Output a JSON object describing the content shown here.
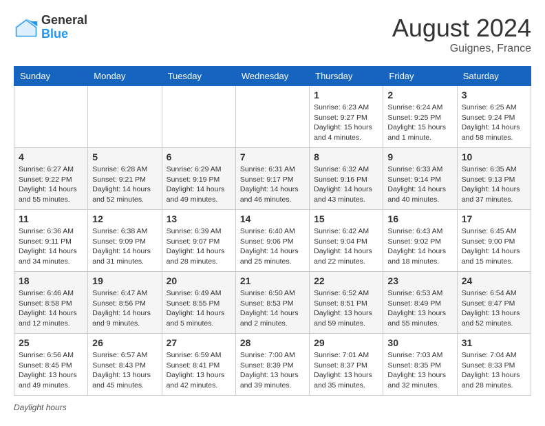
{
  "header": {
    "logo_general": "General",
    "logo_blue": "Blue",
    "month_year": "August 2024",
    "location": "Guignes, France"
  },
  "footer": {
    "daylight_label": "Daylight hours"
  },
  "days_of_week": [
    "Sunday",
    "Monday",
    "Tuesday",
    "Wednesday",
    "Thursday",
    "Friday",
    "Saturday"
  ],
  "weeks": [
    [
      {
        "day": "",
        "sunrise": "",
        "sunset": "",
        "daylight": ""
      },
      {
        "day": "",
        "sunrise": "",
        "sunset": "",
        "daylight": ""
      },
      {
        "day": "",
        "sunrise": "",
        "sunset": "",
        "daylight": ""
      },
      {
        "day": "",
        "sunrise": "",
        "sunset": "",
        "daylight": ""
      },
      {
        "day": "1",
        "sunrise": "Sunrise: 6:23 AM",
        "sunset": "Sunset: 9:27 PM",
        "daylight": "Daylight: 15 hours and 4 minutes."
      },
      {
        "day": "2",
        "sunrise": "Sunrise: 6:24 AM",
        "sunset": "Sunset: 9:25 PM",
        "daylight": "Daylight: 15 hours and 1 minute."
      },
      {
        "day": "3",
        "sunrise": "Sunrise: 6:25 AM",
        "sunset": "Sunset: 9:24 PM",
        "daylight": "Daylight: 14 hours and 58 minutes."
      }
    ],
    [
      {
        "day": "4",
        "sunrise": "Sunrise: 6:27 AM",
        "sunset": "Sunset: 9:22 PM",
        "daylight": "Daylight: 14 hours and 55 minutes."
      },
      {
        "day": "5",
        "sunrise": "Sunrise: 6:28 AM",
        "sunset": "Sunset: 9:21 PM",
        "daylight": "Daylight: 14 hours and 52 minutes."
      },
      {
        "day": "6",
        "sunrise": "Sunrise: 6:29 AM",
        "sunset": "Sunset: 9:19 PM",
        "daylight": "Daylight: 14 hours and 49 minutes."
      },
      {
        "day": "7",
        "sunrise": "Sunrise: 6:31 AM",
        "sunset": "Sunset: 9:17 PM",
        "daylight": "Daylight: 14 hours and 46 minutes."
      },
      {
        "day": "8",
        "sunrise": "Sunrise: 6:32 AM",
        "sunset": "Sunset: 9:16 PM",
        "daylight": "Daylight: 14 hours and 43 minutes."
      },
      {
        "day": "9",
        "sunrise": "Sunrise: 6:33 AM",
        "sunset": "Sunset: 9:14 PM",
        "daylight": "Daylight: 14 hours and 40 minutes."
      },
      {
        "day": "10",
        "sunrise": "Sunrise: 6:35 AM",
        "sunset": "Sunset: 9:13 PM",
        "daylight": "Daylight: 14 hours and 37 minutes."
      }
    ],
    [
      {
        "day": "11",
        "sunrise": "Sunrise: 6:36 AM",
        "sunset": "Sunset: 9:11 PM",
        "daylight": "Daylight: 14 hours and 34 minutes."
      },
      {
        "day": "12",
        "sunrise": "Sunrise: 6:38 AM",
        "sunset": "Sunset: 9:09 PM",
        "daylight": "Daylight: 14 hours and 31 minutes."
      },
      {
        "day": "13",
        "sunrise": "Sunrise: 6:39 AM",
        "sunset": "Sunset: 9:07 PM",
        "daylight": "Daylight: 14 hours and 28 minutes."
      },
      {
        "day": "14",
        "sunrise": "Sunrise: 6:40 AM",
        "sunset": "Sunset: 9:06 PM",
        "daylight": "Daylight: 14 hours and 25 minutes."
      },
      {
        "day": "15",
        "sunrise": "Sunrise: 6:42 AM",
        "sunset": "Sunset: 9:04 PM",
        "daylight": "Daylight: 14 hours and 22 minutes."
      },
      {
        "day": "16",
        "sunrise": "Sunrise: 6:43 AM",
        "sunset": "Sunset: 9:02 PM",
        "daylight": "Daylight: 14 hours and 18 minutes."
      },
      {
        "day": "17",
        "sunrise": "Sunrise: 6:45 AM",
        "sunset": "Sunset: 9:00 PM",
        "daylight": "Daylight: 14 hours and 15 minutes."
      }
    ],
    [
      {
        "day": "18",
        "sunrise": "Sunrise: 6:46 AM",
        "sunset": "Sunset: 8:58 PM",
        "daylight": "Daylight: 14 hours and 12 minutes."
      },
      {
        "day": "19",
        "sunrise": "Sunrise: 6:47 AM",
        "sunset": "Sunset: 8:56 PM",
        "daylight": "Daylight: 14 hours and 9 minutes."
      },
      {
        "day": "20",
        "sunrise": "Sunrise: 6:49 AM",
        "sunset": "Sunset: 8:55 PM",
        "daylight": "Daylight: 14 hours and 5 minutes."
      },
      {
        "day": "21",
        "sunrise": "Sunrise: 6:50 AM",
        "sunset": "Sunset: 8:53 PM",
        "daylight": "Daylight: 14 hours and 2 minutes."
      },
      {
        "day": "22",
        "sunrise": "Sunrise: 6:52 AM",
        "sunset": "Sunset: 8:51 PM",
        "daylight": "Daylight: 13 hours and 59 minutes."
      },
      {
        "day": "23",
        "sunrise": "Sunrise: 6:53 AM",
        "sunset": "Sunset: 8:49 PM",
        "daylight": "Daylight: 13 hours and 55 minutes."
      },
      {
        "day": "24",
        "sunrise": "Sunrise: 6:54 AM",
        "sunset": "Sunset: 8:47 PM",
        "daylight": "Daylight: 13 hours and 52 minutes."
      }
    ],
    [
      {
        "day": "25",
        "sunrise": "Sunrise: 6:56 AM",
        "sunset": "Sunset: 8:45 PM",
        "daylight": "Daylight: 13 hours and 49 minutes."
      },
      {
        "day": "26",
        "sunrise": "Sunrise: 6:57 AM",
        "sunset": "Sunset: 8:43 PM",
        "daylight": "Daylight: 13 hours and 45 minutes."
      },
      {
        "day": "27",
        "sunrise": "Sunrise: 6:59 AM",
        "sunset": "Sunset: 8:41 PM",
        "daylight": "Daylight: 13 hours and 42 minutes."
      },
      {
        "day": "28",
        "sunrise": "Sunrise: 7:00 AM",
        "sunset": "Sunset: 8:39 PM",
        "daylight": "Daylight: 13 hours and 39 minutes."
      },
      {
        "day": "29",
        "sunrise": "Sunrise: 7:01 AM",
        "sunset": "Sunset: 8:37 PM",
        "daylight": "Daylight: 13 hours and 35 minutes."
      },
      {
        "day": "30",
        "sunrise": "Sunrise: 7:03 AM",
        "sunset": "Sunset: 8:35 PM",
        "daylight": "Daylight: 13 hours and 32 minutes."
      },
      {
        "day": "31",
        "sunrise": "Sunrise: 7:04 AM",
        "sunset": "Sunset: 8:33 PM",
        "daylight": "Daylight: 13 hours and 28 minutes."
      }
    ]
  ]
}
